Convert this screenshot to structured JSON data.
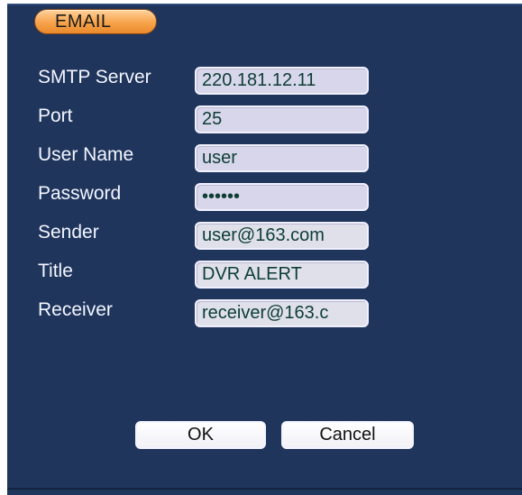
{
  "dialog": {
    "title": "EMAIL"
  },
  "fields": [
    {
      "label": "SMTP Server",
      "value": "220.181.12.11"
    },
    {
      "label": "Port",
      "value": "25"
    },
    {
      "label": "User Name",
      "value": "user"
    },
    {
      "label": "Password",
      "value": "••••••"
    },
    {
      "label": "Sender",
      "value": "user@163.com"
    },
    {
      "label": "Title",
      "value": "DVR ALERT"
    },
    {
      "label": "Receiver",
      "value": "receiver@163.c"
    }
  ],
  "buttons": {
    "ok_label": "OK",
    "cancel_label": "Cancel"
  },
  "colors": {
    "panel_background": "#20355c",
    "tab_gradient": "#f7a24b",
    "field_background": "#d7d6ea",
    "field_text": "#0d3d35"
  }
}
